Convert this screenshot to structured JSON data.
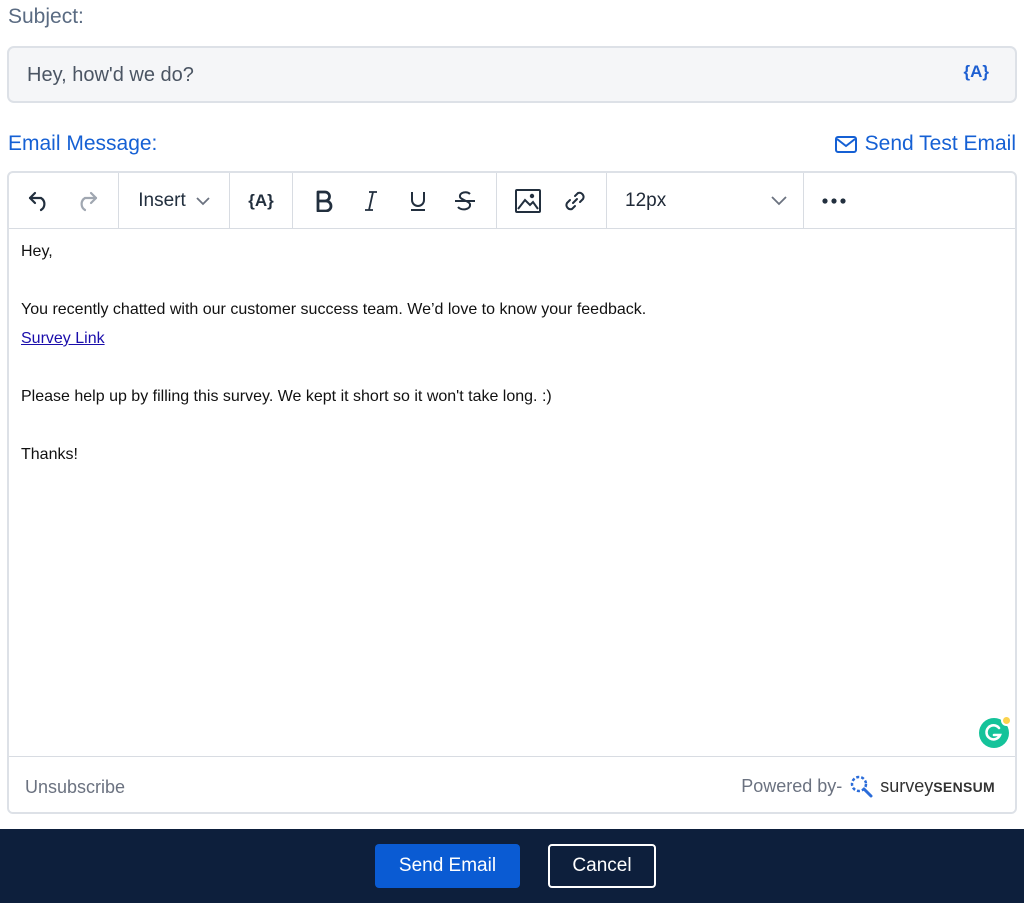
{
  "subject": {
    "label": "Subject:",
    "value": "Hey, how'd we do?",
    "token_label": "{A}"
  },
  "message": {
    "label": "Email Message:",
    "send_test_label": "Send Test Email"
  },
  "toolbar": {
    "insert_label": "Insert",
    "token_label": "{A}",
    "font_size": "12px",
    "icons": [
      "undo-icon",
      "redo-icon",
      "chevron-down-icon",
      "bold-icon",
      "italic-icon",
      "underline-icon",
      "strikethrough-icon",
      "image-icon",
      "link-icon",
      "more-icon"
    ]
  },
  "body": {
    "greeting": "Hey,",
    "line1": "You recently chatted with our customer success team. We’d love to know your feedback.",
    "link_text": "Survey Link",
    "line2": "Please help up by filling this survey. We kept it short so it won't take long. :)",
    "closing": "Thanks!"
  },
  "footer": {
    "unsubscribe": "Unsubscribe",
    "powered_by": "Powered by-",
    "brand_light": "survey",
    "brand_bold": "SENSUM"
  },
  "actions": {
    "send_label": "Send Email",
    "cancel_label": "Cancel"
  },
  "colors": {
    "accent": "#1560d4",
    "primary_button": "#0a5bd3",
    "bottom_bar": "#0d1f3c",
    "grammarly": "#15c39a"
  }
}
